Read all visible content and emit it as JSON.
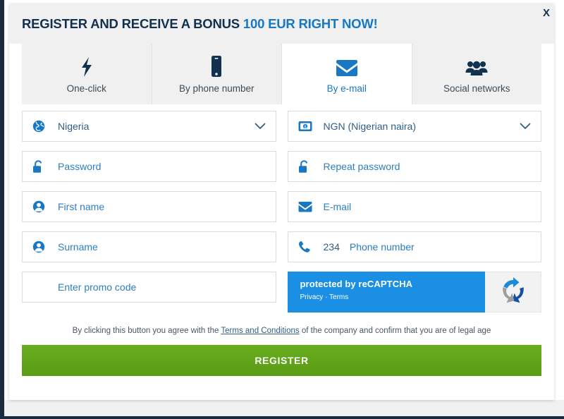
{
  "modal": {
    "title_main": "REGISTER AND RECEIVE A BONUS",
    "title_accent": "100 EUR RIGHT NOW!",
    "close_label": "X"
  },
  "tabs": [
    {
      "label": "One-click",
      "icon": "bolt-icon",
      "active": false
    },
    {
      "label": "By phone number",
      "icon": "mobile-phone-icon",
      "active": false
    },
    {
      "label": "By e-mail",
      "icon": "envelope-icon",
      "active": true
    },
    {
      "label": "Social networks",
      "icon": "people-group-icon",
      "active": false
    }
  ],
  "fields": {
    "country": {
      "value": "Nigeria",
      "icon": "globe-icon"
    },
    "currency": {
      "value": "NGN (Nigerian naira)",
      "icon": "banknote-icon"
    },
    "password": {
      "placeholder": "Password",
      "icon": "unlocked-padlock-icon"
    },
    "repeat_password": {
      "placeholder": "Repeat password",
      "icon": "unlocked-padlock-icon"
    },
    "first_name": {
      "placeholder": "First name",
      "icon": "person-icon"
    },
    "email": {
      "placeholder": "E-mail",
      "icon": "envelope-icon"
    },
    "surname": {
      "placeholder": "Surname",
      "icon": "person-icon"
    },
    "phone": {
      "prefix": "234",
      "placeholder": "Phone number",
      "icon": "phone-handset-icon"
    },
    "promo": {
      "placeholder": "Enter promo code"
    }
  },
  "recaptcha": {
    "title": "protected by reCAPTCHA",
    "privacy": "Privacy",
    "separator": "·",
    "terms": "Terms"
  },
  "terms": {
    "before": "By clicking this button you agree with the ",
    "link": "Terms and Conditions",
    "after": " of the company and confirm that you are of legal age"
  },
  "submit": {
    "label": "REGISTER"
  },
  "colors": {
    "title_dark": "#12314f",
    "title_accent": "#1878c4",
    "icon_blue": "#1878c4",
    "field_text": "#2d7fc1",
    "register_green": "#67ad1c",
    "recaptcha_blue": "#1a8fe3",
    "tab_inactive_bg": "#f0f0f0",
    "header_bg": "#f0f0f0"
  }
}
